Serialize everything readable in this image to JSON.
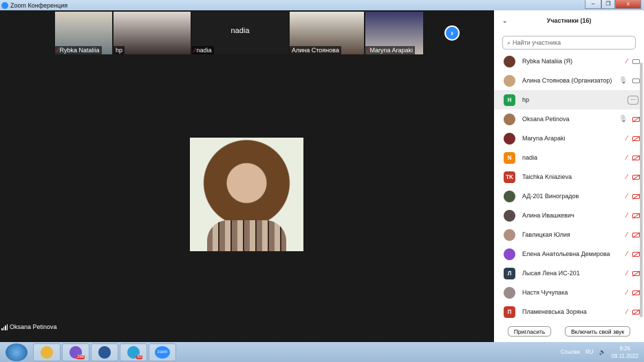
{
  "window": {
    "title": "Zoom Конференция",
    "minimize": "–",
    "restore": "❐",
    "close": "x"
  },
  "strip": {
    "tiles": [
      {
        "name": "Rybka Nataliia",
        "muted": true
      },
      {
        "name": "hp",
        "muted": false
      },
      {
        "name": "nadia",
        "muted": true,
        "display_name": "nadia"
      },
      {
        "name": "Алина Стоянова",
        "muted": false
      },
      {
        "name": "Maryna Arapaki",
        "muted": true
      }
    ],
    "next_icon": "chevron-right-icon"
  },
  "active_speaker": {
    "name": "Oksana Petinova"
  },
  "panel": {
    "title": "Участники (16)",
    "search_placeholder": "Найти участника",
    "participants": [
      {
        "name": "Rybka Nataliia (Я)",
        "avatar": "",
        "color": "#6b3a2a",
        "mic": "off",
        "cam": "on"
      },
      {
        "name": "Алина Стоянова (Организатор)",
        "avatar": "",
        "color": "#c9a37a",
        "mic": "on",
        "cam": "on"
      },
      {
        "name": "hp",
        "avatar": "H",
        "color": "#21a04f",
        "more": "···"
      },
      {
        "name": "Oksana Petinova",
        "avatar": "",
        "color": "#a47552",
        "mic": "on",
        "cam": "off"
      },
      {
        "name": "Maryna Arapaki",
        "avatar": "",
        "color": "#7a2a2a",
        "mic": "off",
        "cam": "off"
      },
      {
        "name": "nadia",
        "avatar": "N",
        "color": "#f0890e",
        "mic": "off",
        "cam": "off"
      },
      {
        "name": "Taichka Kniazieva",
        "avatar": "TK",
        "color": "#c23a2b",
        "mic": "off",
        "cam": "off"
      },
      {
        "name": "АД-201 Виноградов",
        "avatar": "",
        "color": "#4a5a40",
        "mic": "off",
        "cam": "off"
      },
      {
        "name": "Алина Ивашкевич",
        "avatar": "",
        "color": "#5a4a4a",
        "mic": "off",
        "cam": "off"
      },
      {
        "name": "Гавлицкая Юлия",
        "avatar": "",
        "color": "#b09080",
        "mic": "off",
        "cam": "off"
      },
      {
        "name": "Елена Анатольевна Демирова",
        "avatar": "",
        "color": "#8a4ad0",
        "mic": "off",
        "cam": "off"
      },
      {
        "name": "Лысая Лена ИС-201",
        "avatar": "Л",
        "color": "#2e3f52",
        "mic": "off",
        "cam": "off"
      },
      {
        "name": "Настя Чучупака",
        "avatar": "",
        "color": "#9a8a8a",
        "mic": "off",
        "cam": "off"
      },
      {
        "name": "Пламеневська Зоряна",
        "avatar": "П",
        "color": "#c23a2b",
        "mic": "off",
        "cam": "off"
      }
    ],
    "invite": "Пригласить",
    "unmute": "Включить свой звук"
  },
  "taskbar": {
    "apps": [
      {
        "name": "chrome",
        "color": "#e8b53a"
      },
      {
        "name": "viber",
        "color": "#7b54c9",
        "badge": "268"
      },
      {
        "name": "word",
        "color": "#2b5797"
      },
      {
        "name": "telegram",
        "color": "#2ea0d8",
        "badge": "93"
      },
      {
        "name": "zoom",
        "color": "#2d8cff",
        "label": "zoom"
      }
    ],
    "links": "Ссылки",
    "lang": "RU",
    "time": "9:26",
    "date": "09.11.2022"
  }
}
